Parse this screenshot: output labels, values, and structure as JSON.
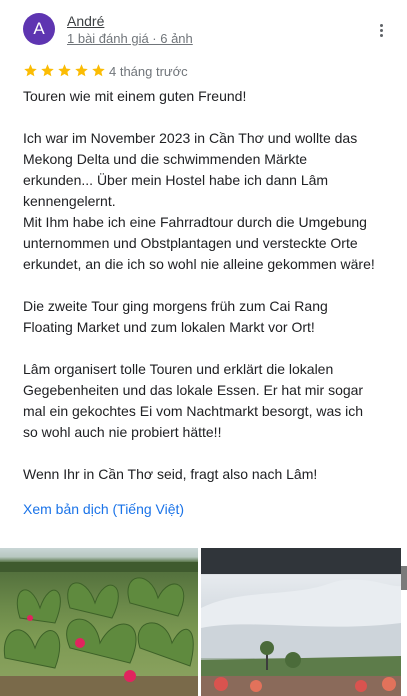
{
  "review": {
    "avatar_letter": "A",
    "avatar_color": "#5e35b1",
    "author": "André",
    "meta": "1 bài đánh giá · 6 ảnh",
    "more_icon": "more-vert-icon",
    "rating": 5,
    "star_color": "#fbbc04",
    "time": "4 tháng trước",
    "paragraphs": [
      "Touren wie mit einem guten Freund!",
      "Ich war im November 2023 in Cần Thơ und wollte das\nMekong Delta und die schwimmenden Märkte\nerkunden... Über mein Hostel habe ich dann Lâm\nkennengelernt.\nMit Ihm habe ich eine Fahrradtour durch die Umgebung\nunternommen und Obstplantagen und versteckte Orte\nerkundet, an die ich so wohl nie alleine gekommen wäre!",
      "Die zweite Tour ging morgens früh zum Cai Rang\nFloating Market und zum lokalen Markt vor Ort!",
      "Lâm organisert tolle Touren und erklärt die lokalen\nGegebenheiten und das lokale Essen. Er hat mir sogar\nmal ein gekochtes Ei vom Nachtmarkt besorgt, was ich\nso wohl auch nie probiert hätte!!",
      "Wenn Ihr in Cần Thơ seid, fragt also nach Lâm!"
    ],
    "translate_link": "Xem bản dịch (Tiếng Việt)",
    "link_color": "#1a73e8"
  }
}
